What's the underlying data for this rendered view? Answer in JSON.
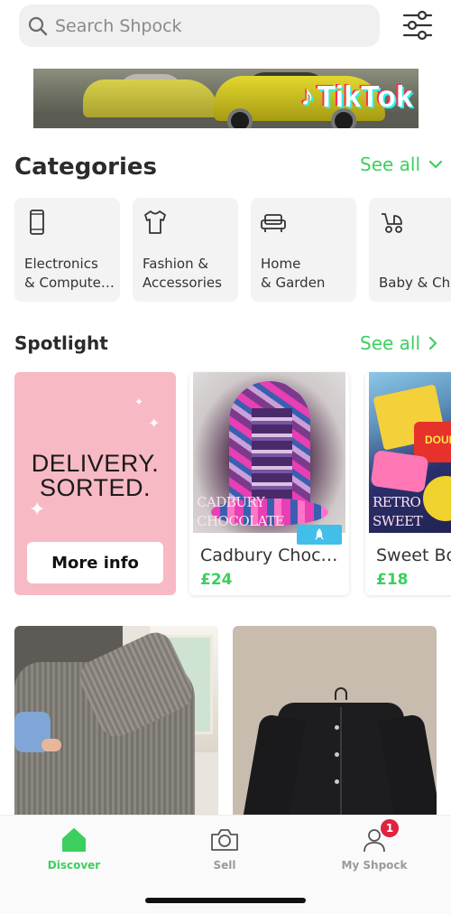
{
  "search": {
    "placeholder": "Search Shpock"
  },
  "banner": {
    "brand": "TikTok"
  },
  "categories": {
    "title": "Categories",
    "see_all": "See all",
    "items": [
      {
        "label": "Electronics\n& Compute…",
        "icon": "phone-icon"
      },
      {
        "label": "Fashion &\nAccessories",
        "icon": "tshirt-icon"
      },
      {
        "label": "Home\n& Garden",
        "icon": "sofa-icon"
      },
      {
        "label": "\nBaby & Chi",
        "icon": "stroller-icon"
      }
    ]
  },
  "spotlight": {
    "title": "Spotlight",
    "see_all": "See all",
    "promo": {
      "headline": "DELIVERY.\nSORTED.",
      "button": "More info"
    },
    "items": [
      {
        "title": "Cadbury Choc…",
        "price": "£24",
        "image_caption": "CADBURY\nCHOCOLATE"
      },
      {
        "title": "Sweet Bo",
        "price": "£18",
        "image_caption": "RETRO\nSWEET"
      }
    ]
  },
  "nav": {
    "items": [
      {
        "label": "Discover",
        "icon": "home-icon",
        "active": true
      },
      {
        "label": "Sell",
        "icon": "camera-icon",
        "active": false
      },
      {
        "label": "My Shpock",
        "icon": "profile-icon",
        "active": false,
        "badge": "1"
      }
    ]
  },
  "colors": {
    "accent": "#3ccf5e",
    "promo_bg": "#f7b9c4",
    "badge": "#e0233f",
    "boost": "#41bfe8"
  }
}
